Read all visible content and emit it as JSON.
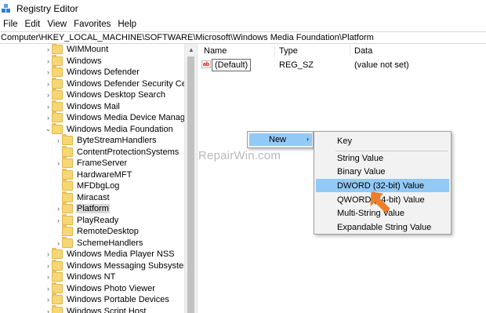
{
  "window": {
    "title": "Registry Editor"
  },
  "menubar": {
    "items": [
      "File",
      "Edit",
      "View",
      "Favorites",
      "Help"
    ]
  },
  "address": {
    "path": "Computer\\HKEY_LOCAL_MACHINE\\SOFTWARE\\Microsoft\\Windows Media Foundation\\Platform"
  },
  "tree": {
    "items": [
      {
        "label": "WIMMount",
        "expander": "chevron-right"
      },
      {
        "label": "Windows",
        "expander": "chevron-right"
      },
      {
        "label": "Windows Defender",
        "expander": "chevron-right"
      },
      {
        "label": "Windows Defender Security Center",
        "expander": "chevron-right"
      },
      {
        "label": "Windows Desktop Search",
        "expander": "chevron-right"
      },
      {
        "label": "Windows Mail",
        "expander": "chevron-right"
      },
      {
        "label": "Windows Media Device Manager",
        "expander": "chevron-right"
      },
      {
        "label": "Windows Media Foundation",
        "expander": "chevron-down"
      },
      {
        "label": "ByteStreamHandlers",
        "expander": "chevron-right"
      },
      {
        "label": "ContentProtectionSystems",
        "expander": ""
      },
      {
        "label": "FrameServer",
        "expander": "chevron-right"
      },
      {
        "label": "HardwareMFT",
        "expander": ""
      },
      {
        "label": "MFDbgLog",
        "expander": ""
      },
      {
        "label": "Miracast",
        "expander": ""
      },
      {
        "label": "Platform",
        "expander": "chevron-right",
        "selected": true
      },
      {
        "label": "PlayReady",
        "expander": "chevron-right"
      },
      {
        "label": "RemoteDesktop",
        "expander": ""
      },
      {
        "label": "SchemeHandlers",
        "expander": "chevron-right"
      },
      {
        "label": "Windows Media Player NSS",
        "expander": "chevron-right"
      },
      {
        "label": "Windows Messaging Subsystem",
        "expander": "chevron-right"
      },
      {
        "label": "Windows NT",
        "expander": "chevron-right"
      },
      {
        "label": "Windows Photo Viewer",
        "expander": "chevron-right"
      },
      {
        "label": "Windows Portable Devices",
        "expander": "chevron-right"
      },
      {
        "label": "Windows Script Host",
        "expander": "chevron-right"
      }
    ]
  },
  "list": {
    "columns": {
      "name": "Name",
      "type": "Type",
      "data": "Data"
    },
    "rows": [
      {
        "icon": "ab",
        "name": "(Default)",
        "type": "REG_SZ",
        "data": "(value not set)"
      }
    ]
  },
  "context_menu": {
    "new_label": "New",
    "arrow": "›"
  },
  "submenu": {
    "items": [
      "Key",
      "String Value",
      "Binary Value",
      "DWORD (32-bit) Value",
      "QWORD (64-bit) Value",
      "Multi-String Value",
      "Expandable String Value"
    ],
    "highlighted": "DWORD (32-bit) Value"
  },
  "watermark": {
    "text": "RepairWin.com"
  },
  "colors": {
    "highlight": "#91c9f7",
    "selected": "#d9d9d9",
    "folder": "#f6d776",
    "cursor_arrow": "#f07d28"
  },
  "icons": {
    "app": "registry-icon",
    "folder": "folder-icon",
    "value": "string-value-icon",
    "pointer": "orange-arrow-icon"
  }
}
